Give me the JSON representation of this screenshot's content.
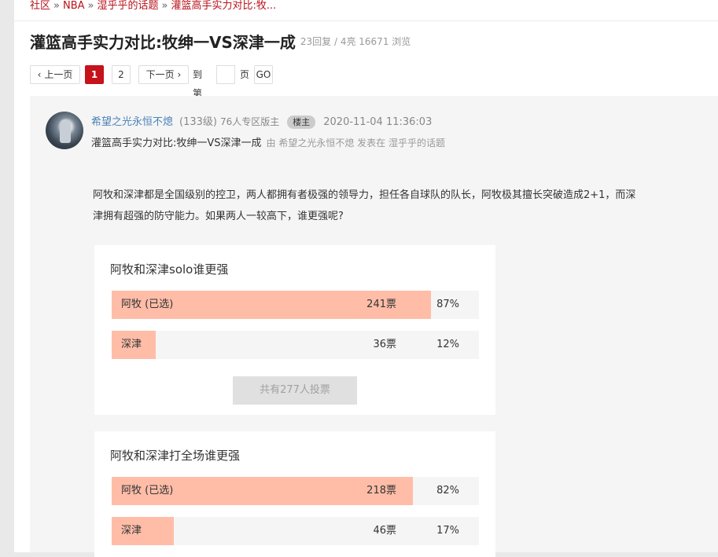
{
  "breadcrumb": {
    "items": [
      "社区",
      "NBA",
      "湿乎乎的话题",
      "灌篮高手实力对比:牧..."
    ],
    "separator": "»"
  },
  "thread": {
    "title": "灌篮高手实力对比:牧绅一VS深津一成",
    "stats": "23回复 / 4亮 16671 浏览"
  },
  "pager": {
    "prev": "上一页",
    "pages": [
      "1",
      "2"
    ],
    "current": "1",
    "next": "下一页",
    "goto_label": "到第",
    "page_unit": "页",
    "go": "GO"
  },
  "post": {
    "author": "希望之光永恒不熄",
    "level": "(133级)",
    "moderator": "76人专区版主",
    "badge": "楼主",
    "time": "2020-11-04 11:36:03",
    "subject": "灌篮高手实力对比:牧绅一VS深津一成",
    "meta": "由 希望之光永恒不熄 发表在 湿乎乎的话题",
    "body_line1": "阿牧和深津都是全国级别的控卫，两人都拥有者极强的领导力，担任各自球队的队长，阿牧极其擅长突破造成2+1，而深",
    "body_line2": "津拥有超强的防守能力。如果两人一较高下，谁更强呢?"
  },
  "polls": [
    {
      "question": "阿牧和深津solo谁更强",
      "options": [
        {
          "label": "阿牧 (已选)",
          "votes": "241票",
          "percent": "87%",
          "fill": 0.87
        },
        {
          "label": "深津",
          "votes": "36票",
          "percent": "12%",
          "fill": 0.12
        }
      ],
      "total": "共有277人投票"
    },
    {
      "question": "阿牧和深津打全场谁更强",
      "options": [
        {
          "label": "阿牧 (已选)",
          "votes": "218票",
          "percent": "82%",
          "fill": 0.82
        },
        {
          "label": "深津",
          "votes": "46票",
          "percent": "17%",
          "fill": 0.17
        }
      ]
    }
  ],
  "colors": {
    "accent": "#c5121b",
    "link": "#b8121b",
    "author": "#4b82b8",
    "poll_fill": "#ffbda8"
  }
}
